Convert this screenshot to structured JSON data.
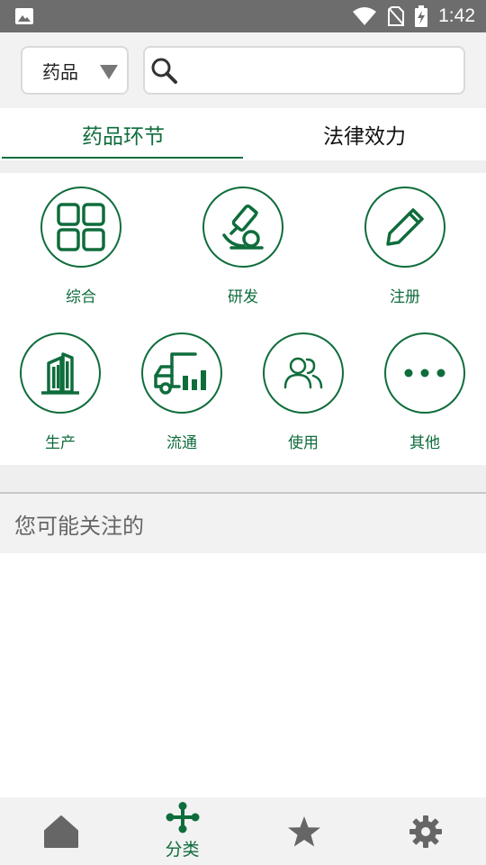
{
  "status_bar": {
    "time": "1:42"
  },
  "search": {
    "category_label": "药品",
    "placeholder": ""
  },
  "tabs": [
    {
      "label": "药品环节",
      "active": true
    },
    {
      "label": "法律效力",
      "active": false
    }
  ],
  "categories": [
    {
      "label": "综合",
      "icon": "grid-icon"
    },
    {
      "label": "研发",
      "icon": "microscope-icon"
    },
    {
      "label": "注册",
      "icon": "pencil-icon"
    },
    {
      "label": "生产",
      "icon": "building-icon"
    },
    {
      "label": "流通",
      "icon": "truck-icon"
    },
    {
      "label": "使用",
      "icon": "users-icon"
    },
    {
      "label": "其他",
      "icon": "more-icon"
    }
  ],
  "recommend": {
    "title": "您可能关注的"
  },
  "bottom_nav": [
    {
      "icon": "home-icon",
      "label": ""
    },
    {
      "icon": "category-icon",
      "label": "分类",
      "active": true
    },
    {
      "icon": "star-icon",
      "label": ""
    },
    {
      "icon": "gear-icon",
      "label": ""
    }
  ],
  "colors": {
    "accent": "#0f6d3c",
    "status_bar": "#6d6d6d",
    "background": "#efefef"
  }
}
